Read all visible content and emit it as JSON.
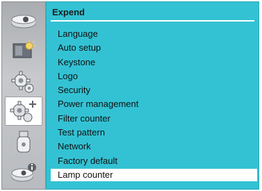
{
  "panel": {
    "title": "Expend",
    "items": [
      {
        "label": "Language"
      },
      {
        "label": "Auto setup"
      },
      {
        "label": "Keystone"
      },
      {
        "label": "Logo"
      },
      {
        "label": "Security"
      },
      {
        "label": "Power management"
      },
      {
        "label": "Filter counter"
      },
      {
        "label": "Test pattern"
      },
      {
        "label": "Network"
      },
      {
        "label": "Factory default"
      },
      {
        "label": "Lamp counter"
      }
    ],
    "selected_index": 10
  },
  "sidebar": {
    "items": [
      {
        "icon": "input-icon"
      },
      {
        "icon": "image-adjust-icon"
      },
      {
        "icon": "setting-icon"
      },
      {
        "icon": "expand-settings-icon",
        "active": true
      },
      {
        "icon": "usb-icon"
      },
      {
        "icon": "info-icon"
      }
    ]
  },
  "colors": {
    "panel_background": "#33c2d4",
    "selection_background": "#ffffff",
    "sidebar_background": "#b8bbbf"
  }
}
